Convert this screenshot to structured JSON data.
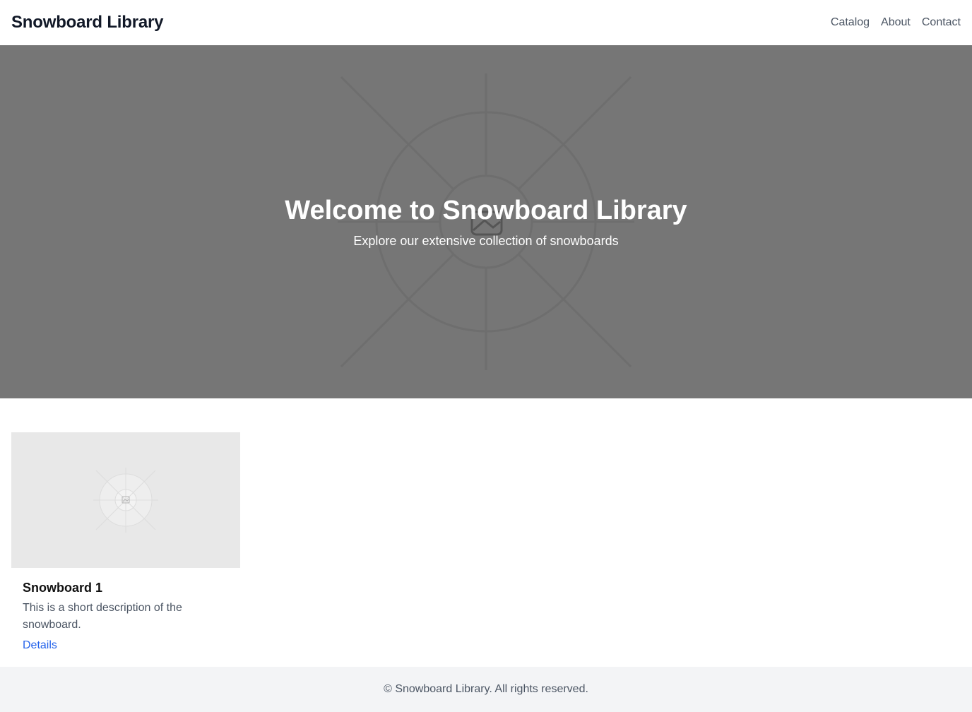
{
  "header": {
    "brand": "Snowboard Library",
    "nav": [
      {
        "label": "Catalog"
      },
      {
        "label": "About"
      },
      {
        "label": "Contact"
      }
    ]
  },
  "hero": {
    "title": "Welcome to Snowboard Library",
    "subtitle": "Explore our extensive collection of snowboards",
    "image_icon": "image-placeholder-icon"
  },
  "cards": [
    {
      "title": "Snowboard 1",
      "description": "This is a short description of the snowboard.",
      "link_label": "Details",
      "image_icon": "image-placeholder-icon"
    }
  ],
  "footer": {
    "text": "© Snowboard Library. All rights reserved."
  },
  "colors": {
    "hero_bg": "#767676",
    "link": "#2563eb",
    "footer_bg": "#f3f4f6",
    "card_image_bg": "#e8e8e8"
  }
}
